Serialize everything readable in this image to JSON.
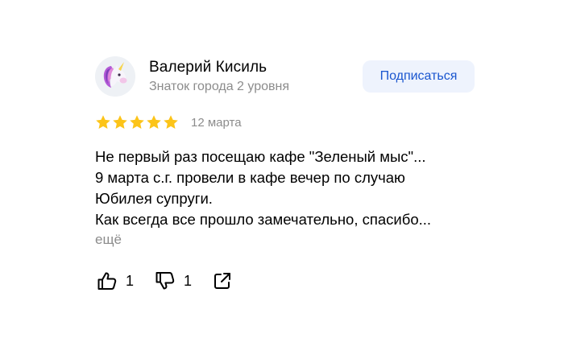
{
  "author": {
    "name": "Валерий Кисиль",
    "level": "Знаток города 2 уровня",
    "avatar_icon": "unicorn-icon"
  },
  "subscribe_button": {
    "label": "Подписаться",
    "color": "#1a56cf",
    "background": "#eef3fd"
  },
  "rating": {
    "stars": 5,
    "max": 5,
    "star_color": "#fcc419",
    "date": "12 марта"
  },
  "review": {
    "lines": [
      "Не первый раз посещаю кафе \"Зеленый мыс\"...",
      "9 марта с.г. провели в кафе вечер по случаю",
      "Юбилея супруги.",
      "Как всегда все прошло замечательно, спасибо..."
    ],
    "more_label": "ещё"
  },
  "actions": {
    "like": {
      "icon": "thumbs-up-icon",
      "count": "1"
    },
    "dislike": {
      "icon": "thumbs-down-icon",
      "count": "1"
    },
    "share": {
      "icon": "share-icon"
    }
  }
}
